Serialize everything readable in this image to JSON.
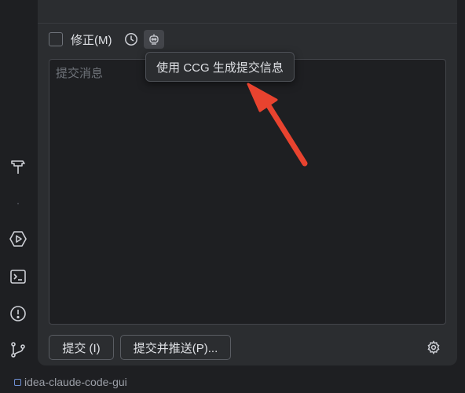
{
  "commit_panel": {
    "amend_label": "修正(M)",
    "message_placeholder": "提交消息",
    "commit_button": "提交 (I)",
    "commit_and_push_button": "提交并推送(P)..."
  },
  "tooltip": {
    "text": "使用 CCG 生成提交信息"
  },
  "left_stripe": {
    "icons": [
      "build-hammer-icon",
      "run-services-icon",
      "terminal-icon",
      "problems-icon",
      "git-branch-icon"
    ]
  },
  "status_bar": {
    "project_name": "idea-claude-code-gui"
  },
  "colors": {
    "annotation_arrow": "#e8432f",
    "background": "#1e1f22",
    "panel": "#2b2d30"
  }
}
